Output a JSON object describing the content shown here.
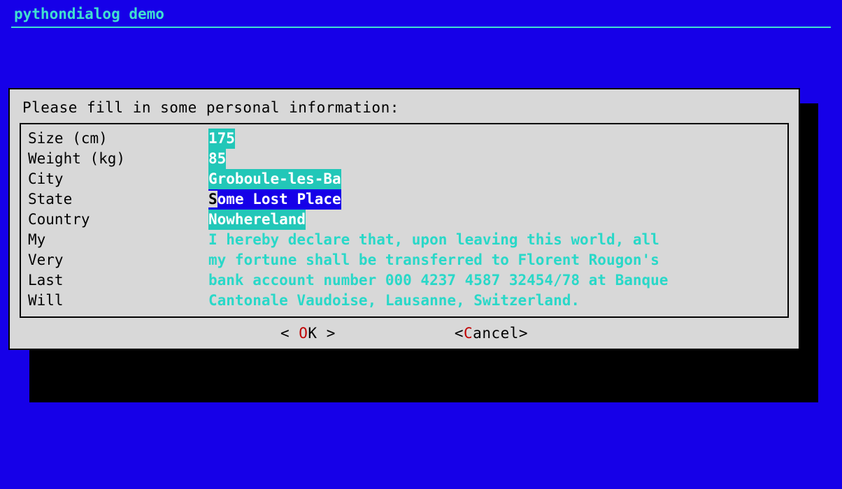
{
  "header": {
    "title": "pythondialog demo"
  },
  "dialog": {
    "prompt": "Please fill in some personal information:",
    "labels": {
      "size": "Size (cm)",
      "weight": "Weight (kg)",
      "city": "City",
      "state": "State",
      "country": "Country",
      "will1": "My",
      "will2": "Very",
      "will3": "Last",
      "will4": "Will"
    },
    "fields": {
      "size": "175",
      "weight": "85",
      "city": "Groboule-les-Ba",
      "state_first": "S",
      "state_rest": "ome Lost Place",
      "country": "Nowhereland",
      "will_line1": "I hereby declare that, upon leaving this world, all",
      "will_line2": "my fortune shall be transferred to Florent Rougon's",
      "will_line3": "bank account number 000 4237 4587 32454/78 at Banque",
      "will_line4": "Cantonale Vaudoise, Lausanne, Switzerland."
    },
    "buttons": {
      "ok_hot": "O",
      "ok_rest": "K",
      "cancel_hot": "C",
      "cancel_rest": "ancel"
    }
  }
}
